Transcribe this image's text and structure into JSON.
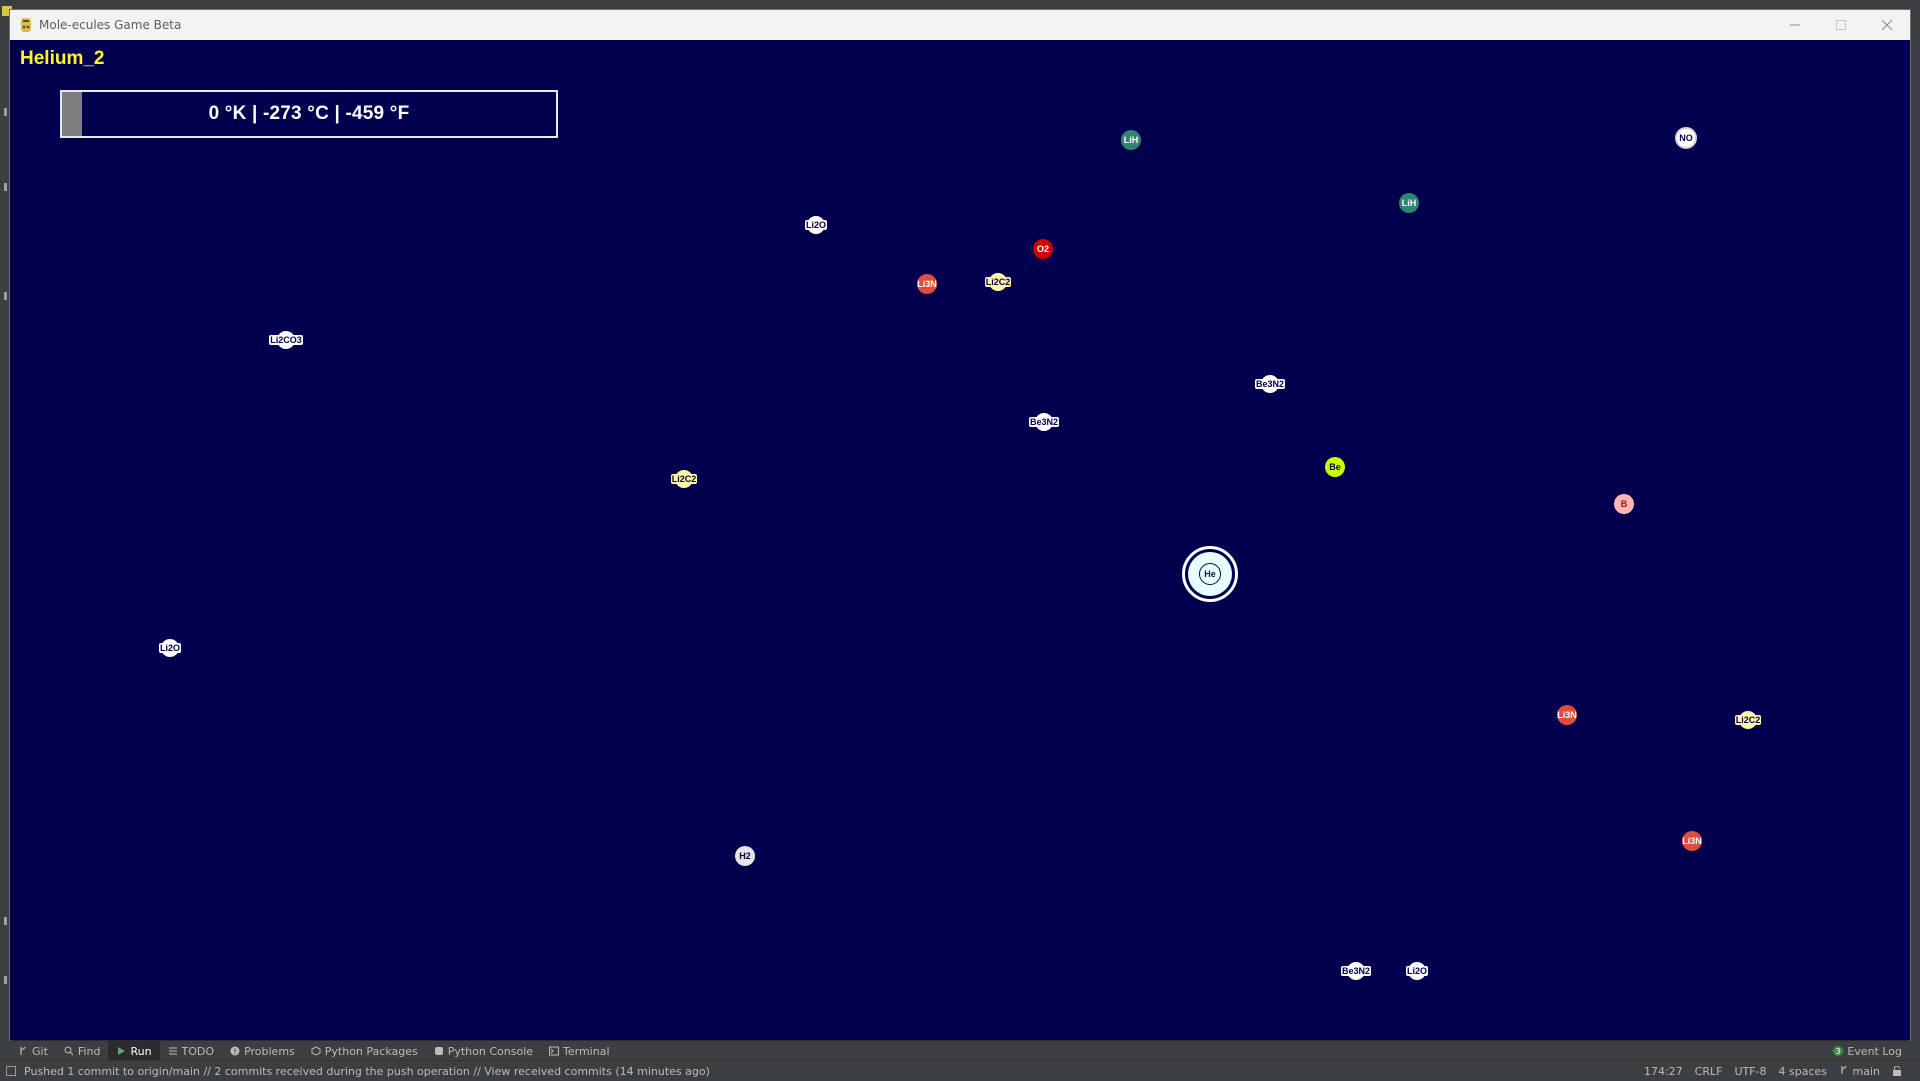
{
  "window": {
    "title": "Mole-ecules Game Beta",
    "icon": "python-icon"
  },
  "game": {
    "level_title": "Helium_2",
    "temperature": {
      "text": "0 °K  |  -273 °C  |  -459 °F",
      "progress_fraction": 0.0
    },
    "player": {
      "label": "He",
      "color": "#e8ffff"
    },
    "molecules": [
      {
        "label": "LiH",
        "color": "#2f8573",
        "text_color": "#ffffff",
        "kind": "circle"
      },
      {
        "label": "NO",
        "color": "#ffffff",
        "text_color": "#02004e",
        "kind": "ring"
      },
      {
        "label": "LiH",
        "color": "#2f8573",
        "text_color": "#ffffff",
        "kind": "circle"
      },
      {
        "label": "Li2O",
        "color": "#ffffff",
        "text_color": "#02004e",
        "kind": "pill"
      },
      {
        "label": "O2",
        "color": "#cf0000",
        "text_color": "#ffffff",
        "kind": "circle"
      },
      {
        "label": "Li3N",
        "color": "#de4d3e",
        "text_color": "#ffffff",
        "kind": "circle"
      },
      {
        "label": "Li2C2",
        "color": "#fff7a8",
        "text_color": "#02004e",
        "kind": "pill"
      },
      {
        "label": "Li2CO3",
        "color": "#ffffff",
        "text_color": "#02004e",
        "kind": "pill"
      },
      {
        "label": "Be3N2",
        "color": "#ffffff",
        "text_color": "#02004e",
        "kind": "pill"
      },
      {
        "label": "Be3N2",
        "color": "#ffffff",
        "text_color": "#02004e",
        "kind": "pill"
      },
      {
        "label": "Li2C2",
        "color": "#fff7a8",
        "text_color": "#02004e",
        "kind": "pill"
      },
      {
        "label": "Be",
        "color": "#c8ff00",
        "text_color": "#02004e",
        "kind": "circle"
      },
      {
        "label": "B",
        "color": "#ffb5b5",
        "text_color": "#8a1e1e",
        "kind": "circle"
      },
      {
        "label": "Li2O",
        "color": "#ffffff",
        "text_color": "#02004e",
        "kind": "pill"
      },
      {
        "label": "Li3N",
        "color": "#de4d3e",
        "text_color": "#ffffff",
        "kind": "circle"
      },
      {
        "label": "Li2C2",
        "color": "#fff7a8",
        "text_color": "#02004e",
        "kind": "pill"
      },
      {
        "label": "Li3N",
        "color": "#de4d3e",
        "text_color": "#ffffff",
        "kind": "circle"
      },
      {
        "label": "H2",
        "color": "#e5e5e5",
        "text_color": "#02004e",
        "kind": "circle"
      },
      {
        "label": "Be3N2",
        "color": "#ffffff",
        "text_color": "#02004e",
        "kind": "pill"
      },
      {
        "label": "Li2O",
        "color": "#ffffff",
        "text_color": "#02004e",
        "kind": "pill"
      }
    ]
  },
  "tool_windows": {
    "left": [
      {
        "label": "Git",
        "icon": "git-branch-icon",
        "active": false
      },
      {
        "label": "Find",
        "icon": "search-icon",
        "active": false
      },
      {
        "label": "Run",
        "icon": "run-icon",
        "active": true
      },
      {
        "label": "TODO",
        "icon": "todo-list-icon",
        "active": false
      },
      {
        "label": "Problems",
        "icon": "problems-icon",
        "active": false
      },
      {
        "label": "Python Packages",
        "icon": "packages-icon",
        "active": false
      },
      {
        "label": "Python Console",
        "icon": "python-console-icon",
        "active": false
      },
      {
        "label": "Terminal",
        "icon": "terminal-icon",
        "active": false
      }
    ],
    "event_log": {
      "label": "Event Log",
      "count": "3",
      "icon": "event-log-icon"
    }
  },
  "status": {
    "message": "Pushed 1 commit to origin/main // 2 commits received during the push operation // View received commits (14 minutes ago)",
    "position": "174:27",
    "line_ending": "CRLF",
    "encoding": "UTF-8",
    "indent": "4 spaces",
    "branch": "main"
  }
}
